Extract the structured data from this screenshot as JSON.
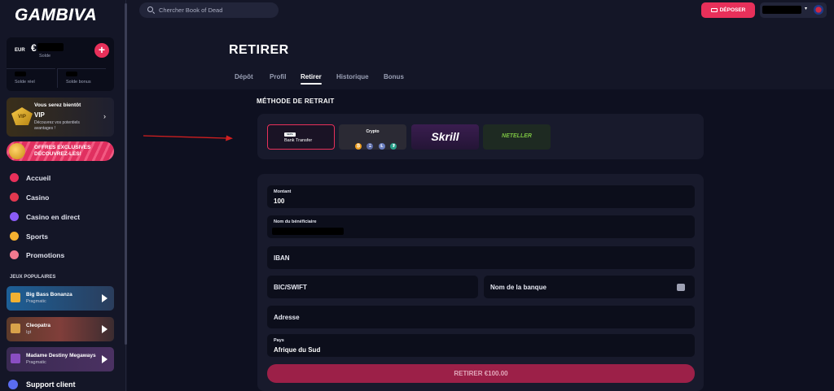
{
  "sidebar": {
    "logo": "GAMBIVA",
    "wallet": {
      "currency": "EUR",
      "amount": "€",
      "balance_label": "Solde",
      "real_label": "Solde réel",
      "bonus_label": "Solde bonus",
      "add_label": "+"
    },
    "vip": {
      "badge": "VIP",
      "line1": "Vous serez bientôt",
      "line2": "VIP",
      "line3": "Découvrez vos potentiels avantages !",
      "chevron": "›"
    },
    "offers": {
      "line1": "OFFRES EXCLUSIVES",
      "line2": "DÉCOUVREZ-LES!"
    },
    "nav": [
      {
        "label": "Accueil",
        "icon": "home-icon",
        "color": "#e8305a"
      },
      {
        "label": "Casino",
        "icon": "casino-icon",
        "color": "#e2384f"
      },
      {
        "label": "Casino en direct",
        "icon": "live-casino-icon",
        "color": "#8b5cf6"
      },
      {
        "label": "Sports",
        "icon": "sports-icon",
        "color": "#f5b130"
      },
      {
        "label": "Promotions",
        "icon": "promotions-icon",
        "color": "#f27a8f"
      }
    ],
    "popular_title": "JEUX POPULAIRES",
    "games": [
      {
        "name": "Big Bass Bonanza",
        "provider": "Pragmatic",
        "bg": "#1f6fb0"
      },
      {
        "name": "Cleopatra",
        "provider": "Igt",
        "bg": "#6b4230"
      },
      {
        "name": "Madame Destiny Megaways",
        "provider": "Pragmatic",
        "bg": "#3a2a52"
      }
    ],
    "support_label": "Support client"
  },
  "topbar": {
    "search_placeholder": "Chercher Book of Dead",
    "deposit_label": "DÉPOSER",
    "account_chevron": "▾"
  },
  "page": {
    "title": "RETIRER",
    "tabs": [
      "Dépôt",
      "Profil",
      "Retirer",
      "Historique",
      "Bonus"
    ],
    "active_tab": "Retirer"
  },
  "methods": {
    "title": "MÉTHODE DE RETRAIT",
    "items": [
      {
        "label": "Bank Transfer",
        "logo": "SEPA"
      },
      {
        "label": "Crypto",
        "coins": [
          "₿",
          "Ξ",
          "Ł",
          "₮"
        ]
      },
      {
        "label": "Skrill"
      },
      {
        "label": "NETELLER"
      }
    ]
  },
  "form": {
    "amount_label": "Montant",
    "amount_value": "100",
    "beneficiary_label": "Nom du bénéficiaire",
    "iban_placeholder": "IBAN",
    "bic_placeholder": "BIC/SWIFT",
    "bank_name_placeholder": "Nom de la banque",
    "address_placeholder": "Adresse",
    "country_label": "Pays",
    "country_value": "Afrique du Sud",
    "submit_label": "RETIRER €100.00"
  },
  "colors": {
    "accent": "#e8305a",
    "background": "#141627",
    "panel": "#181a2c",
    "field": "#0c0e1b"
  }
}
